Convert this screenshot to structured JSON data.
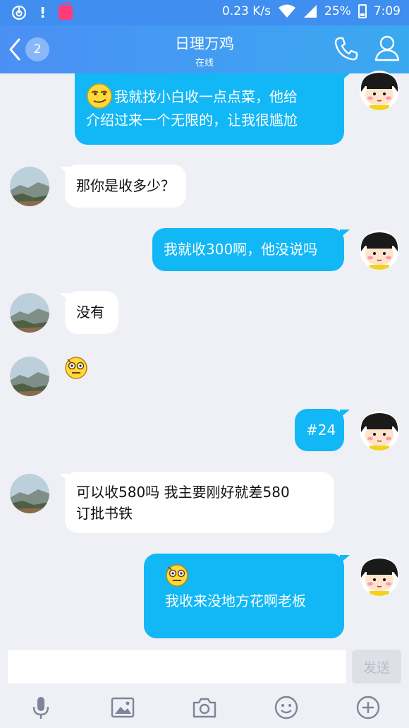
{
  "statusbar": {
    "network_speed": "0.23 K/s",
    "battery": "25%",
    "time": "7:09",
    "icons": [
      "netease-music-icon",
      "alert-icon",
      "shopping-bag-icon",
      "wifi-icon",
      "signal-icon",
      "battery-icon"
    ]
  },
  "header": {
    "back_badge": "2",
    "contact_name": "日理万鸡",
    "contact_status": "在线",
    "icons": [
      "back-arrow-icon",
      "phone-icon",
      "profile-icon"
    ]
  },
  "messages": [
    {
      "side": "out",
      "emoji": "smirk-emoji",
      "text_line1": "我就找小白收一点点菜，他给",
      "text_line2": "介绍过来一个无限的，让我很尴尬"
    },
    {
      "side": "in",
      "text": "那你是收多少？"
    },
    {
      "side": "out",
      "text": "我就收300啊，他没说吗"
    },
    {
      "side": "in",
      "text": "没有"
    },
    {
      "side": "in",
      "emoji": "awkward-emoji"
    },
    {
      "side": "out",
      "text": "#24"
    },
    {
      "side": "in",
      "text_line1": "可以收580吗  我主要刚好就差580",
      "text_line2": "订批书铁"
    },
    {
      "side": "out",
      "emoji": "awkward-emoji",
      "text": "我收来没地方花啊老板"
    }
  ],
  "input": {
    "placeholder": "",
    "value": "",
    "send_label": "发送"
  },
  "toolbar": {
    "icons": [
      "microphone-icon",
      "image-icon",
      "camera-icon",
      "emoji-icon",
      "plus-icon"
    ]
  },
  "colors": {
    "accent": "#12b7f5",
    "header": "#4b8ff5",
    "background": "#eef0f6"
  }
}
